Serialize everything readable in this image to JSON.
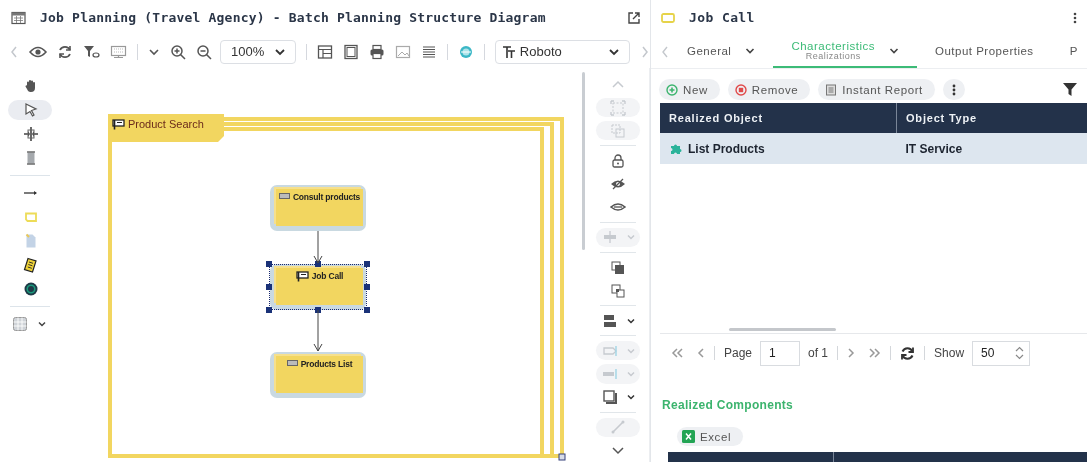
{
  "diagram_window": {
    "title": "Job Planning (Travel Agency) - Batch Planning Structure Diagram",
    "zoom": "100%",
    "font": "Roboto"
  },
  "palette": [
    {
      "selected": false
    },
    {
      "selected": true
    },
    {
      "selected": false
    },
    {
      "selected": false
    },
    {
      "selected": false
    },
    {
      "selected": false
    },
    {
      "selected": false
    },
    {
      "selected": false
    },
    {
      "selected": false
    },
    {
      "selected": false
    }
  ],
  "diagram": {
    "frame": {
      "title": "Product Search"
    },
    "nodes": [
      {
        "label": "Consult products",
        "kind": "data",
        "selected": false
      },
      {
        "label": "Job Call",
        "kind": "job",
        "selected": true
      },
      {
        "label": "Products List",
        "kind": "data",
        "selected": false
      }
    ]
  },
  "arrange_tools": [
    {
      "disabled": true
    },
    {
      "disabled": true
    },
    {
      "disabled": true
    },
    {
      "disabled": false
    },
    {
      "disabled": false
    },
    {
      "disabled": false
    },
    {
      "disabled": true
    },
    {
      "disabled": false
    },
    {
      "disabled": false
    },
    {
      "disabled": false
    },
    {
      "disabled": true
    },
    {
      "disabled": true
    },
    {
      "disabled": false
    },
    {
      "disabled": true
    },
    {
      "disabled": false
    }
  ],
  "properties": {
    "title": "Job Call",
    "tabs": [
      {
        "label": "General",
        "selected": false,
        "menu": true
      },
      {
        "label": "Characteristics",
        "sublabel": "Realizations",
        "selected": true,
        "menu": true
      },
      {
        "label": "Output Properties",
        "selected": false,
        "menu": false
      },
      {
        "label": "P",
        "selected": false,
        "menu": false
      }
    ],
    "actions": [
      {
        "label": "New",
        "kind": "add"
      },
      {
        "label": "Remove",
        "kind": "remove"
      },
      {
        "label": "Instant Report",
        "kind": "report"
      }
    ],
    "table": {
      "columns": [
        "Realized Object",
        "Object Type"
      ],
      "rows": [
        {
          "cells": [
            "List Products",
            "IT Service"
          ],
          "selected": true
        }
      ]
    },
    "pager": {
      "page_label": "Page",
      "page": "1",
      "of": "of 1",
      "show_label": "Show",
      "show": "50"
    },
    "section_title": "Realized Components",
    "export_button": "Excel"
  }
}
